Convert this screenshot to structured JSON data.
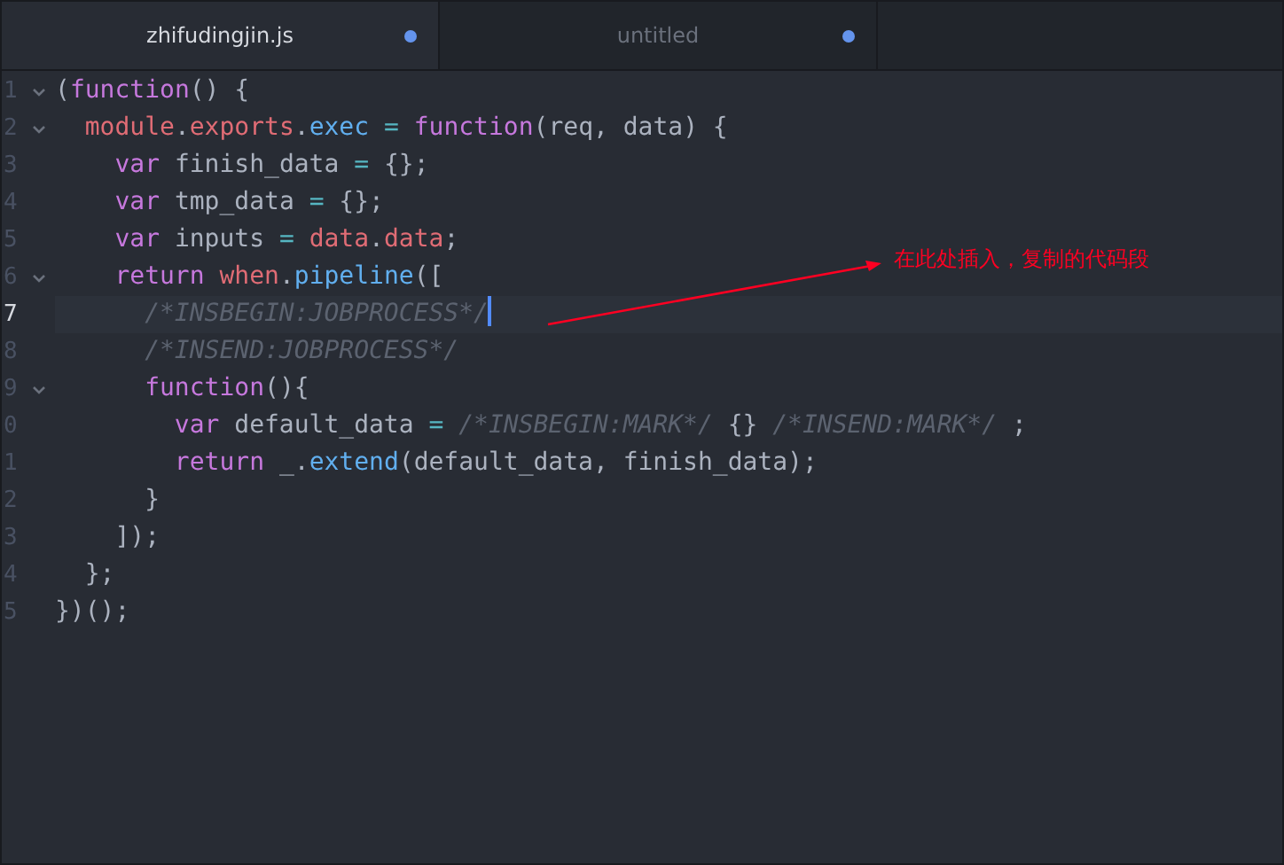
{
  "tabs": [
    {
      "title": "zhifudingjin.js",
      "selected": true,
      "modified": true
    },
    {
      "title": "untitled",
      "selected": false,
      "modified": true
    }
  ],
  "editor": {
    "lines": [
      {
        "number": "1",
        "fold": true,
        "cursor": false,
        "tokens": [
          {
            "kind": "plain",
            "t": "("
          },
          {
            "kind": "keyword",
            "t": "function"
          },
          {
            "kind": "plain",
            "t": "() {"
          }
        ]
      },
      {
        "number": "2",
        "fold": true,
        "cursor": false,
        "tokens": [
          {
            "kind": "var",
            "t": "  module"
          },
          {
            "kind": "plain",
            "t": "."
          },
          {
            "kind": "var",
            "t": "exports"
          },
          {
            "kind": "plain",
            "t": "."
          },
          {
            "kind": "func",
            "t": "exec"
          },
          {
            "kind": "op",
            "t": " = "
          },
          {
            "kind": "keyword",
            "t": "function"
          },
          {
            "kind": "plain",
            "t": "(req, data) {"
          }
        ]
      },
      {
        "number": "3",
        "fold": false,
        "cursor": false,
        "tokens": [
          {
            "kind": "keyword",
            "t": "    var"
          },
          {
            "kind": "plain",
            "t": " finish_data "
          },
          {
            "kind": "op",
            "t": "="
          },
          {
            "kind": "plain",
            "t": " {};"
          }
        ]
      },
      {
        "number": "4",
        "fold": false,
        "cursor": false,
        "tokens": [
          {
            "kind": "keyword",
            "t": "    var"
          },
          {
            "kind": "plain",
            "t": " tmp_data "
          },
          {
            "kind": "op",
            "t": "="
          },
          {
            "kind": "plain",
            "t": " {};"
          }
        ]
      },
      {
        "number": "5",
        "fold": false,
        "cursor": false,
        "tokens": [
          {
            "kind": "keyword",
            "t": "    var"
          },
          {
            "kind": "plain",
            "t": " inputs "
          },
          {
            "kind": "op",
            "t": "="
          },
          {
            "kind": "var",
            "t": " data"
          },
          {
            "kind": "plain",
            "t": "."
          },
          {
            "kind": "var",
            "t": "data"
          },
          {
            "kind": "plain",
            "t": ";"
          }
        ]
      },
      {
        "number": "6",
        "fold": true,
        "cursor": false,
        "tokens": [
          {
            "kind": "keyword",
            "t": "    return"
          },
          {
            "kind": "var",
            "t": " when"
          },
          {
            "kind": "plain",
            "t": "."
          },
          {
            "kind": "func",
            "t": "pipeline"
          },
          {
            "kind": "plain",
            "t": "(["
          }
        ]
      },
      {
        "number": "7",
        "fold": false,
        "cursor": true,
        "tokens": [
          {
            "kind": "comment",
            "t": "      /*INSBEGIN:JOBPROCESS*/"
          }
        ]
      },
      {
        "number": "8",
        "fold": false,
        "cursor": false,
        "tokens": [
          {
            "kind": "comment",
            "t": "      /*INSEND:JOBPROCESS*/"
          }
        ]
      },
      {
        "number": "9",
        "fold": true,
        "cursor": false,
        "tokens": [
          {
            "kind": "keyword",
            "t": "      function"
          },
          {
            "kind": "plain",
            "t": "(){"
          }
        ]
      },
      {
        "number": "0",
        "fold": false,
        "cursor": false,
        "tokens": [
          {
            "kind": "keyword",
            "t": "        var"
          },
          {
            "kind": "plain",
            "t": " default_data "
          },
          {
            "kind": "op",
            "t": "="
          },
          {
            "kind": "comment",
            "t": " /*INSBEGIN:MARK*/"
          },
          {
            "kind": "plain",
            "t": " {} "
          },
          {
            "kind": "comment",
            "t": "/*INSEND:MARK*/"
          },
          {
            "kind": "plain",
            "t": " ;"
          }
        ]
      },
      {
        "number": "1",
        "fold": false,
        "cursor": false,
        "tokens": [
          {
            "kind": "keyword",
            "t": "        return"
          },
          {
            "kind": "plain",
            "t": " _."
          },
          {
            "kind": "func",
            "t": "extend"
          },
          {
            "kind": "plain",
            "t": "(default_data, finish_data);"
          }
        ]
      },
      {
        "number": "2",
        "fold": false,
        "cursor": false,
        "tokens": [
          {
            "kind": "plain",
            "t": "      }"
          }
        ]
      },
      {
        "number": "3",
        "fold": false,
        "cursor": false,
        "tokens": [
          {
            "kind": "plain",
            "t": "    ]);"
          }
        ]
      },
      {
        "number": "4",
        "fold": false,
        "cursor": false,
        "tokens": [
          {
            "kind": "plain",
            "t": "  };"
          }
        ]
      },
      {
        "number": "5",
        "fold": false,
        "cursor": false,
        "tokens": [
          {
            "kind": "plain",
            "t": "})();"
          }
        ]
      }
    ]
  },
  "annotation": {
    "text": "在此处插入，复制的代码段"
  }
}
